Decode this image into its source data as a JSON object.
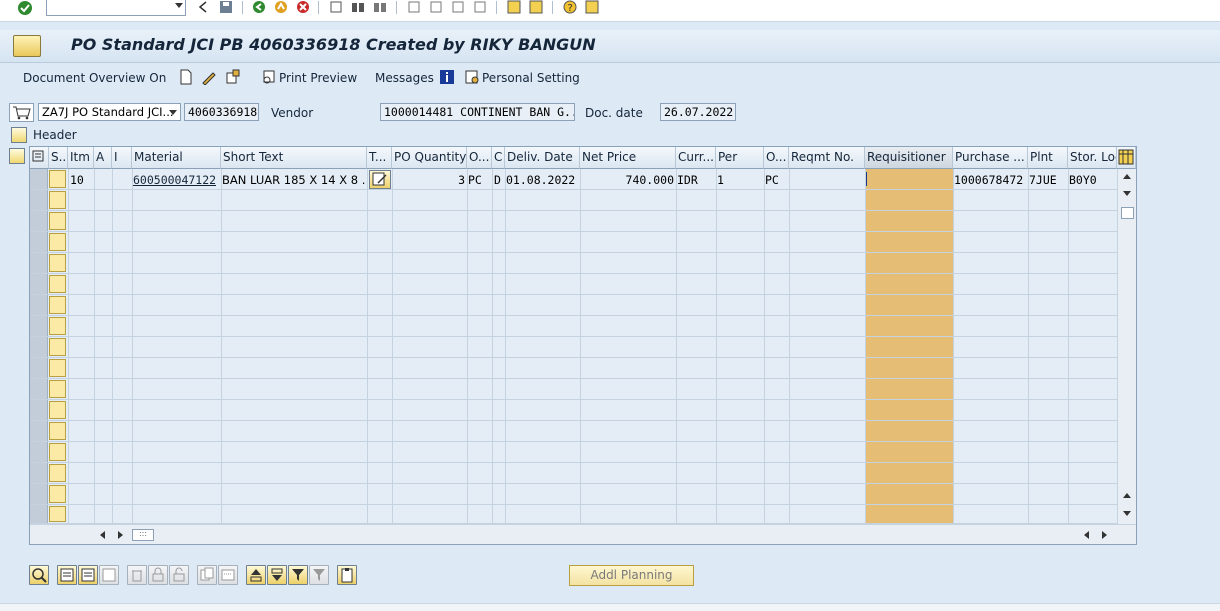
{
  "window": {
    "title": "PO Standard JCI PB 4060336918 Created by RIKY BANGUN"
  },
  "app_toolbar": {
    "document_overview": "Document Overview On",
    "print_preview": "Print Preview",
    "messages": "Messages",
    "personal_setting": "Personal Setting"
  },
  "header": {
    "doc_type": "ZA7J PO Standard JCI...",
    "po_number": "4060336918",
    "vendor_label": "Vendor",
    "vendor_value": "1000014481 CONTINENT BAN G...",
    "doc_date_label": "Doc. date",
    "doc_date_value": "26.07.2022",
    "header_label": "Header"
  },
  "grid": {
    "columns": [
      "S..",
      "Itm",
      "A",
      "I",
      "Material",
      "Short Text",
      "T...",
      "PO Quantity",
      "O...",
      "C",
      "Deliv. Date",
      "Net Price",
      "Curr...",
      "Per",
      "O...",
      "Reqmt No.",
      "Requisitioner",
      "Purchase ...",
      "Plnt",
      "Stor. Loc"
    ],
    "rows": [
      {
        "itm": "10",
        "material": "600500047122",
        "short_text": "BAN LUAR 185 X 14 X 8 ...",
        "po_quantity": "3",
        "order_unit": "PC",
        "c": "D",
        "deliv_date": "01.08.2022",
        "net_price": "740.000",
        "currency": "IDR",
        "per": "1",
        "order_price_unit": "PC",
        "reqmt_no": "",
        "requisitioner": "",
        "purchase_req": "1000678472",
        "plant": "7JUE",
        "stor_loc": "B0Y0"
      }
    ]
  },
  "bottom": {
    "addl_planning": "Addl Planning"
  }
}
